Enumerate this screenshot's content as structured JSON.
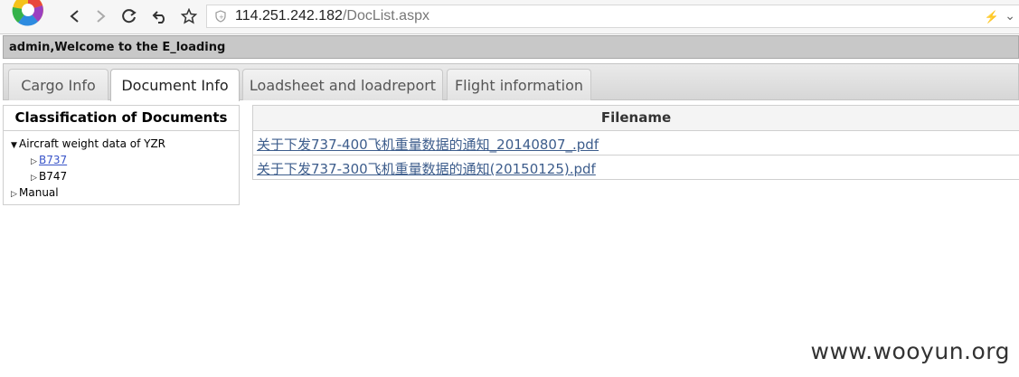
{
  "browser": {
    "url_host": "114.251.242.182",
    "url_path": "/DocList.aspx"
  },
  "welcome": "admin,Welcome to the E_loading",
  "tabs": [
    {
      "label": "Cargo Info",
      "active": false
    },
    {
      "label": "Document Info",
      "active": true
    },
    {
      "label": "Loadsheet and loadreport",
      "active": false
    },
    {
      "label": "Flight information",
      "active": false
    }
  ],
  "tree": {
    "title": "Classification of Documents",
    "nodes": [
      {
        "label": "Aircraft weight data of YZR",
        "expanded": true
      },
      {
        "label": "B737",
        "link": true
      },
      {
        "label": "B747",
        "link": false
      },
      {
        "label": "Manual",
        "expanded": false
      }
    ]
  },
  "files": {
    "header": "Filename",
    "rows": [
      "关于下发737-400飞机重量数据的通知_20140807_.pdf",
      "关于下发737-300飞机重量数据的通知(20150125).pdf"
    ]
  },
  "watermark": "www.wooyun.org"
}
